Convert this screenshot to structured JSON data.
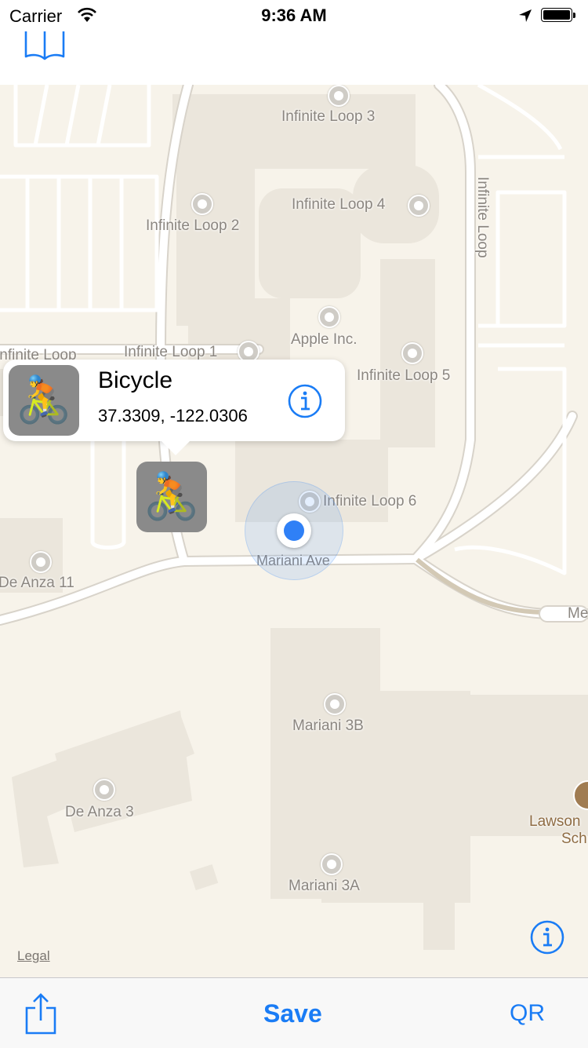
{
  "status_bar": {
    "carrier": "Carrier",
    "time": "9:36 AM"
  },
  "nav": {
    "bookmarks_icon": "book-icon"
  },
  "map": {
    "labels": {
      "il3": "Infinite Loop 3",
      "il4": "Infinite Loop 4",
      "il2": "Infinite Loop 2",
      "il_street_vertical": "Infinite Loop",
      "il_street_left": "Infinite Loop",
      "il1": "Infinite Loop 1",
      "apple": "Apple Inc.",
      "il5": "Infinite Loop 5",
      "il6": "Infinite Loop 6",
      "mariani_ave": "Mariani Ave",
      "de_anza_11": "De Anza 11",
      "me": "Me",
      "mariani_3b": "Mariani 3B",
      "de_anza_3": "De Anza 3",
      "lawson": "Lawson",
      "sch": "Sch",
      "mariani_3a": "Mariani 3A",
      "legal": "Legal"
    },
    "callout": {
      "title": "Bicycle",
      "coordinates": "37.3309, -122.0306",
      "emoji": "🚴"
    },
    "pin": {
      "emoji": "🚴"
    }
  },
  "toolbar": {
    "save_label": "Save",
    "qr_label": "QR"
  },
  "colors": {
    "accent": "#1a7cf5",
    "map_background": "#f7f3ea",
    "building": "#ebe6dc",
    "user_location": "#2f80f6"
  }
}
